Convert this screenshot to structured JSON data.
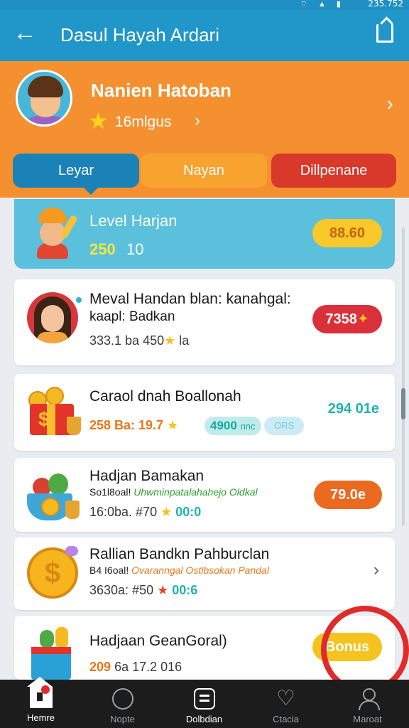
{
  "status_bar": {
    "time": "235.752",
    "icons": [
      "wifi-icon",
      "signal-icon",
      "battery-icon"
    ]
  },
  "app_bar": {
    "title": "Dasul Hayah Ardari"
  },
  "profile": {
    "name": "Nanien Hatoban",
    "subtitle": "16mlgus"
  },
  "tabs": [
    {
      "label": "Leyar",
      "active": true
    },
    {
      "label": "Nayan",
      "active": false
    },
    {
      "label": "Dillpenane",
      "active": false
    }
  ],
  "level_card": {
    "title": "Level Harjan",
    "value_a": "250",
    "value_b": "10",
    "badge": "88.60"
  },
  "items": [
    {
      "title": "Meval Handan blan: kanahgal:",
      "title2": "kaapl: Badkan",
      "meta": "333.1 ba  450",
      "meta_suffix": "la",
      "badge": "7358",
      "badge_color": "#d9303a"
    },
    {
      "title": "Caraol dnah Boallonah",
      "meta": "258 Ba: 19.7",
      "chip1": "4900",
      "chip1_suffix": "nnc",
      "chip2": "ORS",
      "value": "294 01e"
    },
    {
      "title": "Hadjan Bamakan",
      "sub_prefix": "So1l8oal!",
      "sub_text": "Uhwminpatalahahejo Oldkal",
      "meta": "16:0ba. #70",
      "meta_value": "00:0",
      "badge": "79.0e",
      "badge_color": "#ea6a20"
    },
    {
      "title": "Rallian Bandkn Pahburclan",
      "sub_prefix": "B4 I6oal!",
      "sub_text": "Ovaranngal Ostlbsokan Pandal",
      "meta": "3630a: #50",
      "meta_value": "00:6"
    },
    {
      "title": "Hadjaan GeanGoral)",
      "meta_a": "209",
      "meta_b": "6a 17.2  016",
      "badge": "Bonus",
      "badge_color": "#f6c21e"
    }
  ],
  "bottom_nav": [
    {
      "label": "Hemre",
      "icon": "home-icon",
      "active": true
    },
    {
      "label": "Nopte",
      "icon": "clock-icon",
      "active": false
    },
    {
      "label": "Dolbdian",
      "icon": "grid-icon",
      "active": true
    },
    {
      "label": "Ctacia",
      "icon": "heart-icon",
      "active": false
    },
    {
      "label": "Maroat",
      "icon": "user-icon",
      "active": false
    }
  ],
  "colors": {
    "app_bar": "#2196c9",
    "profile_bg": "#f4902f",
    "accent_blue": "#5ac0dc",
    "teal_text": "#1fb3b0"
  }
}
